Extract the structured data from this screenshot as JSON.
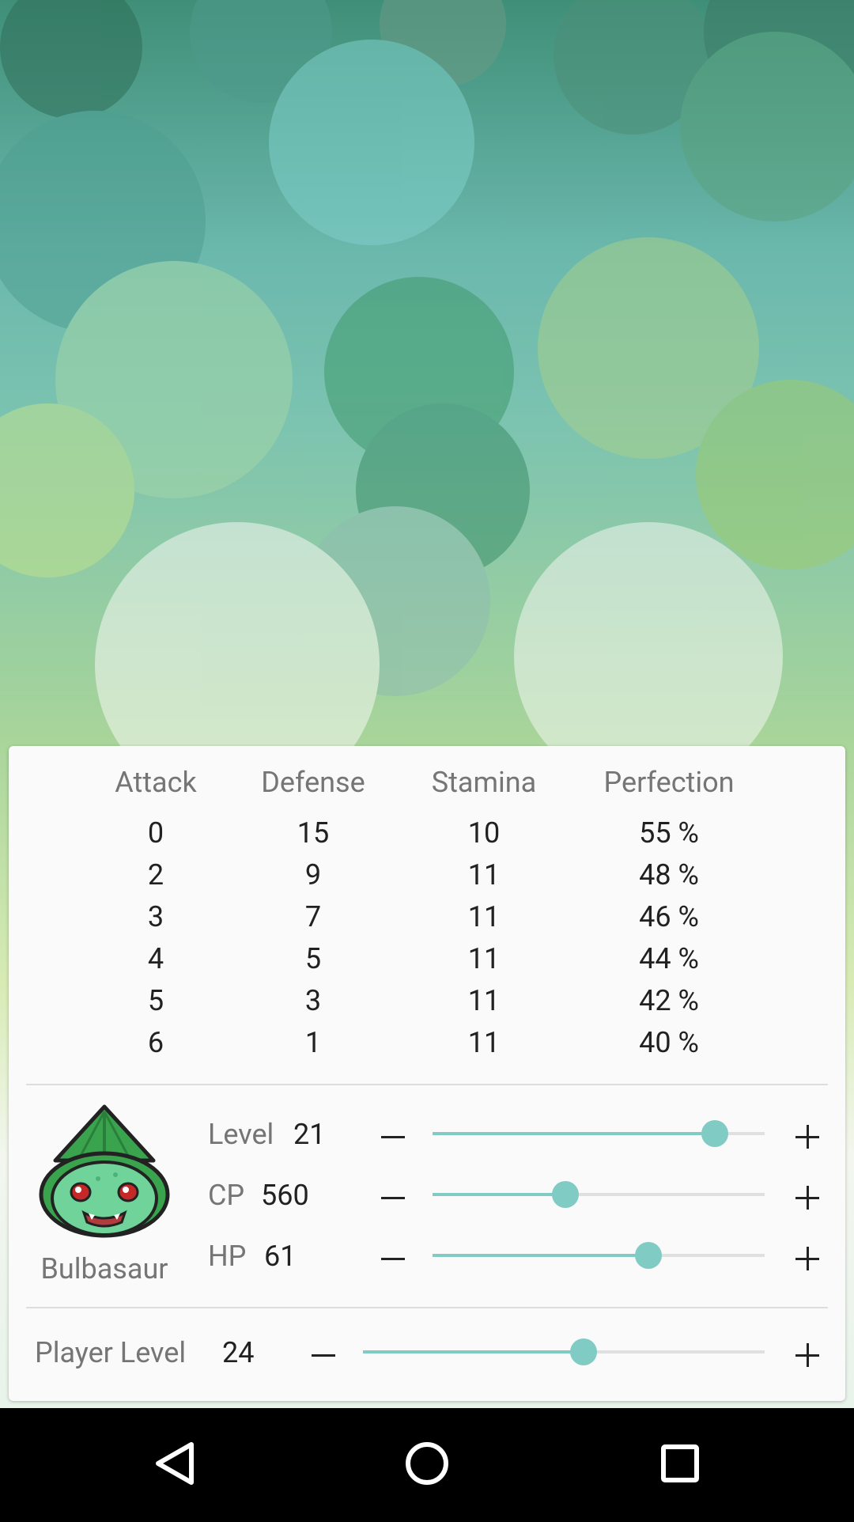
{
  "colors": {
    "accent": "#80cbc4",
    "card": "#fafafa",
    "label": "#757575",
    "text": "#212121"
  },
  "iv_table": {
    "headers": [
      "Attack",
      "Defense",
      "Stamina",
      "Perfection"
    ],
    "rows": [
      [
        "0",
        "15",
        "10",
        "55 %"
      ],
      [
        "2",
        "9",
        "11",
        "48 %"
      ],
      [
        "3",
        "7",
        "11",
        "46 %"
      ],
      [
        "4",
        "5",
        "11",
        "44 %"
      ],
      [
        "5",
        "3",
        "11",
        "42 %"
      ],
      [
        "6",
        "1",
        "11",
        "40 %"
      ]
    ]
  },
  "pokemon": {
    "name": "Bulbasaur",
    "avatar_icon": "bulbasaur-icon",
    "stats": [
      {
        "label": "Level",
        "value": "21",
        "progress": 0.85
      },
      {
        "label": "CP",
        "value": "560",
        "progress": 0.4
      },
      {
        "label": "HP",
        "value": "61",
        "progress": 0.65
      }
    ]
  },
  "player": {
    "label": "Player Level",
    "value": "24",
    "progress": 0.55
  },
  "icons": {
    "minus": "minus-icon",
    "plus": "plus-icon",
    "nav_back": "back-triangle-icon",
    "nav_home": "home-circle-icon",
    "nav_recents": "recents-square-icon"
  }
}
